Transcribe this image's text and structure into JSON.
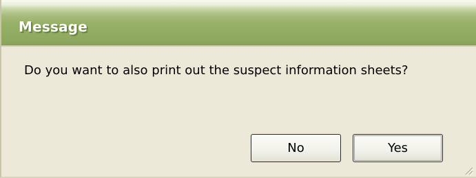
{
  "window": {
    "title": "Message"
  },
  "message": {
    "text": "Do you want to also print out the suspect information sheets?"
  },
  "buttons": {
    "no_label": "No",
    "yes_label": "Yes"
  },
  "colors": {
    "dialog_background": "#ece9d8",
    "titlebar_green": "#97b168",
    "title_text": "#ffffff"
  },
  "icons": {
    "resize_grip": "size-grip-icon"
  }
}
